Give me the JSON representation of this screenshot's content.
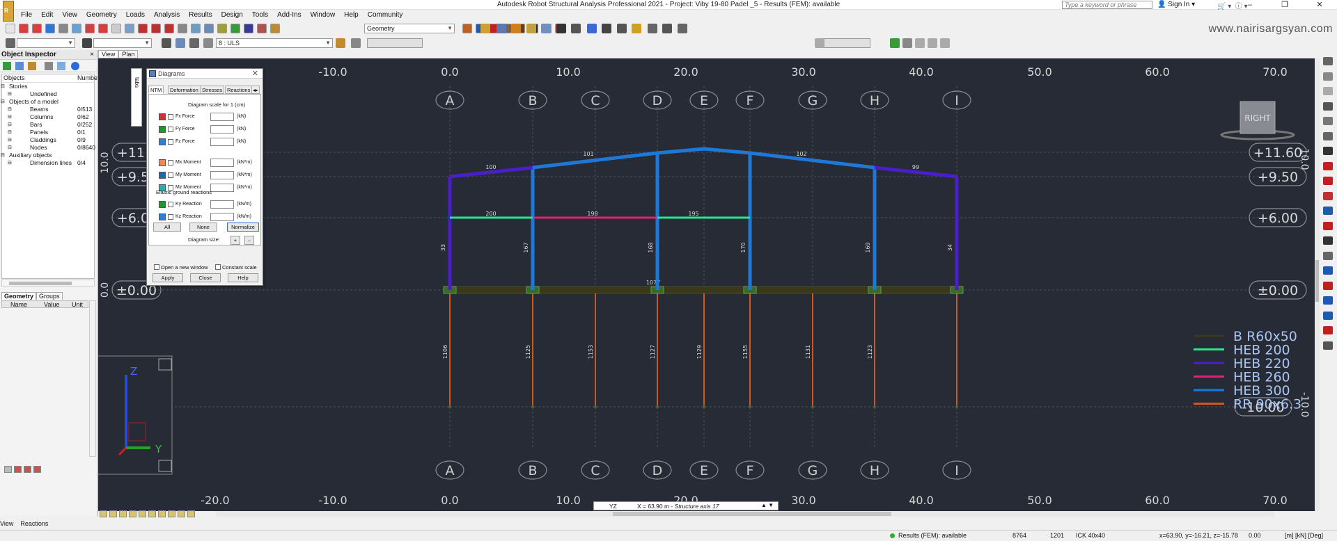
{
  "titlebar": {
    "title": "Autodesk Robot Structural Analysis Professional 2021 - Project: Viby 19-80 Padel _5 - Results (FEM): available",
    "search_placeholder": "Type a keyword or phrase",
    "signin": "Sign In",
    "minimize": "–",
    "restore": "❐",
    "close": "✕"
  },
  "menu": [
    "File",
    "Edit",
    "View",
    "Geometry",
    "Loads",
    "Analysis",
    "Results",
    "Design",
    "Tools",
    "Add-Ins",
    "Window",
    "Help",
    "Community"
  ],
  "toolbar": {
    "layout_combo": "Geometry",
    "case_combo": "8 : ULS",
    "watermark": "www.nairisargsyan.com"
  },
  "inspector": {
    "title": "Object Inspector",
    "close": "×",
    "col_objects": "Objects",
    "col_number": "Numbe",
    "tree": [
      {
        "label": "Stories",
        "count": "",
        "indent": 1
      },
      {
        "label": "Undefined",
        "count": "",
        "indent": 2
      },
      {
        "label": "Objects of a model",
        "count": "",
        "indent": 1
      },
      {
        "label": "Beams",
        "count": "0/513",
        "indent": 2
      },
      {
        "label": "Columns",
        "count": "0/62",
        "indent": 2
      },
      {
        "label": "Bars",
        "count": "0/252",
        "indent": 2
      },
      {
        "label": "Panels",
        "count": "0/1",
        "indent": 2
      },
      {
        "label": "Claddings",
        "count": "0/9",
        "indent": 2
      },
      {
        "label": "Nodes",
        "count": "0/8640",
        "indent": 2
      },
      {
        "label": "Auxiliary objects",
        "count": "",
        "indent": 1
      },
      {
        "label": "Dimension lines",
        "count": "0/4",
        "indent": 2
      }
    ],
    "tabs": [
      "Geometry",
      "Groups"
    ],
    "prop_cols": [
      "Name",
      "Value",
      "Unit"
    ]
  },
  "view_tabs": [
    "View",
    "Plan"
  ],
  "viewport": {
    "top_ruler": [
      "-10.0",
      "0.0",
      "10.0",
      "20.0",
      "30.0",
      "40.0",
      "50.0",
      "60.0",
      "70.0"
    ],
    "bottom_ruler": [
      "-20.0",
      "-10.0",
      "0.0",
      "10.0",
      "20.0",
      "30.0",
      "40.0",
      "50.0",
      "60.0",
      "70.0"
    ],
    "axes": [
      "A",
      "B",
      "C",
      "D",
      "E",
      "F",
      "G",
      "H",
      "I"
    ],
    "levels_right": [
      "+11.60",
      "+9.50",
      "+6.00",
      "±0.00"
    ],
    "levels_left": [
      "+11.",
      "+9.5",
      "+6.0",
      "±0.00",
      "-10.00"
    ],
    "level_right_bottom": "-10.00",
    "side_ticks": [
      "10.0",
      "0.0",
      "-10.0"
    ],
    "view_cube": "RIGHT",
    "rafter_values": [
      "100",
      "101",
      "102",
      "99"
    ],
    "beam_values": [
      "200",
      "198",
      "195"
    ],
    "column_values": [
      "33",
      "167",
      "168",
      "170",
      "169",
      "34"
    ],
    "ground_value": "1077",
    "pile_values": [
      "1106",
      "1125",
      "1153",
      "1127",
      "1129",
      "1155",
      "1131",
      "1123"
    ],
    "legend": [
      {
        "label": "B R60x50",
        "color": "#3a3a1a"
      },
      {
        "label": "HEB 200",
        "color": "#2ee68a"
      },
      {
        "label": "HEB 220",
        "color": "#4b1fc8"
      },
      {
        "label": "HEB 260",
        "color": "#e0207a"
      },
      {
        "label": "HEB 300",
        "color": "#1e78d8"
      },
      {
        "label": "RR 90x6.3",
        "color": "#d0581c"
      }
    ],
    "triad": {
      "z": "Z",
      "y": "Y"
    }
  },
  "diagrams": {
    "title": "Diagrams",
    "close": "✕",
    "tabs_strip": "tabs",
    "tabs": [
      "NTM",
      "Deformation",
      "Stresses",
      "Reactions"
    ],
    "scale_label": "Diagram scale for 1   (cm)",
    "rows": [
      {
        "label": "Fx Force",
        "unit": "(kN)",
        "color": "#d03030"
      },
      {
        "label": "Fy Force",
        "unit": "(kN)",
        "color": "#1a9a2a"
      },
      {
        "label": "Fz Force",
        "unit": "(kN)",
        "color": "#2a80d8"
      },
      {
        "label": "Mx Moment",
        "unit": "(kN*m)",
        "color": "#f08a50"
      },
      {
        "label": "My Moment",
        "unit": "(kN*m)",
        "color": "#1a6ab0"
      },
      {
        "label": "Mz Moment",
        "unit": "(kN*m)",
        "color": "#20b0b0"
      }
    ],
    "elastic_label": "Elastic ground reactions",
    "elastic_rows": [
      {
        "label": "Ky Reaction",
        "unit": "(kN/m)",
        "color": "#1a9a2a"
      },
      {
        "label": "Kz Reaction",
        "unit": "(kN/m)",
        "color": "#2a80d8"
      }
    ],
    "btn_all": "All",
    "btn_none": "None",
    "btn_normalize": "Normalize",
    "size_label": "Diagram size:",
    "plus": "+",
    "minus": "–",
    "open_new_window": "Open a new window",
    "constant_scale": "Constant scale",
    "btn_apply": "Apply",
    "btn_close": "Close",
    "btn_help": "Help"
  },
  "coord_box": {
    "plane": "YZ",
    "value": "X = 63.90 m - ",
    "axis": "Structure axis 17"
  },
  "lower_tabs": [
    "View",
    "Reactions"
  ],
  "status": {
    "results": "Results (FEM): available",
    "nodes": "8764",
    "bars": "1201",
    "section": "ICK 40x40",
    "coords": "x=63.90, y=-16.21, z=-15.78",
    "angle": "0.00",
    "units": "[m] [kN] [Deg]"
  }
}
